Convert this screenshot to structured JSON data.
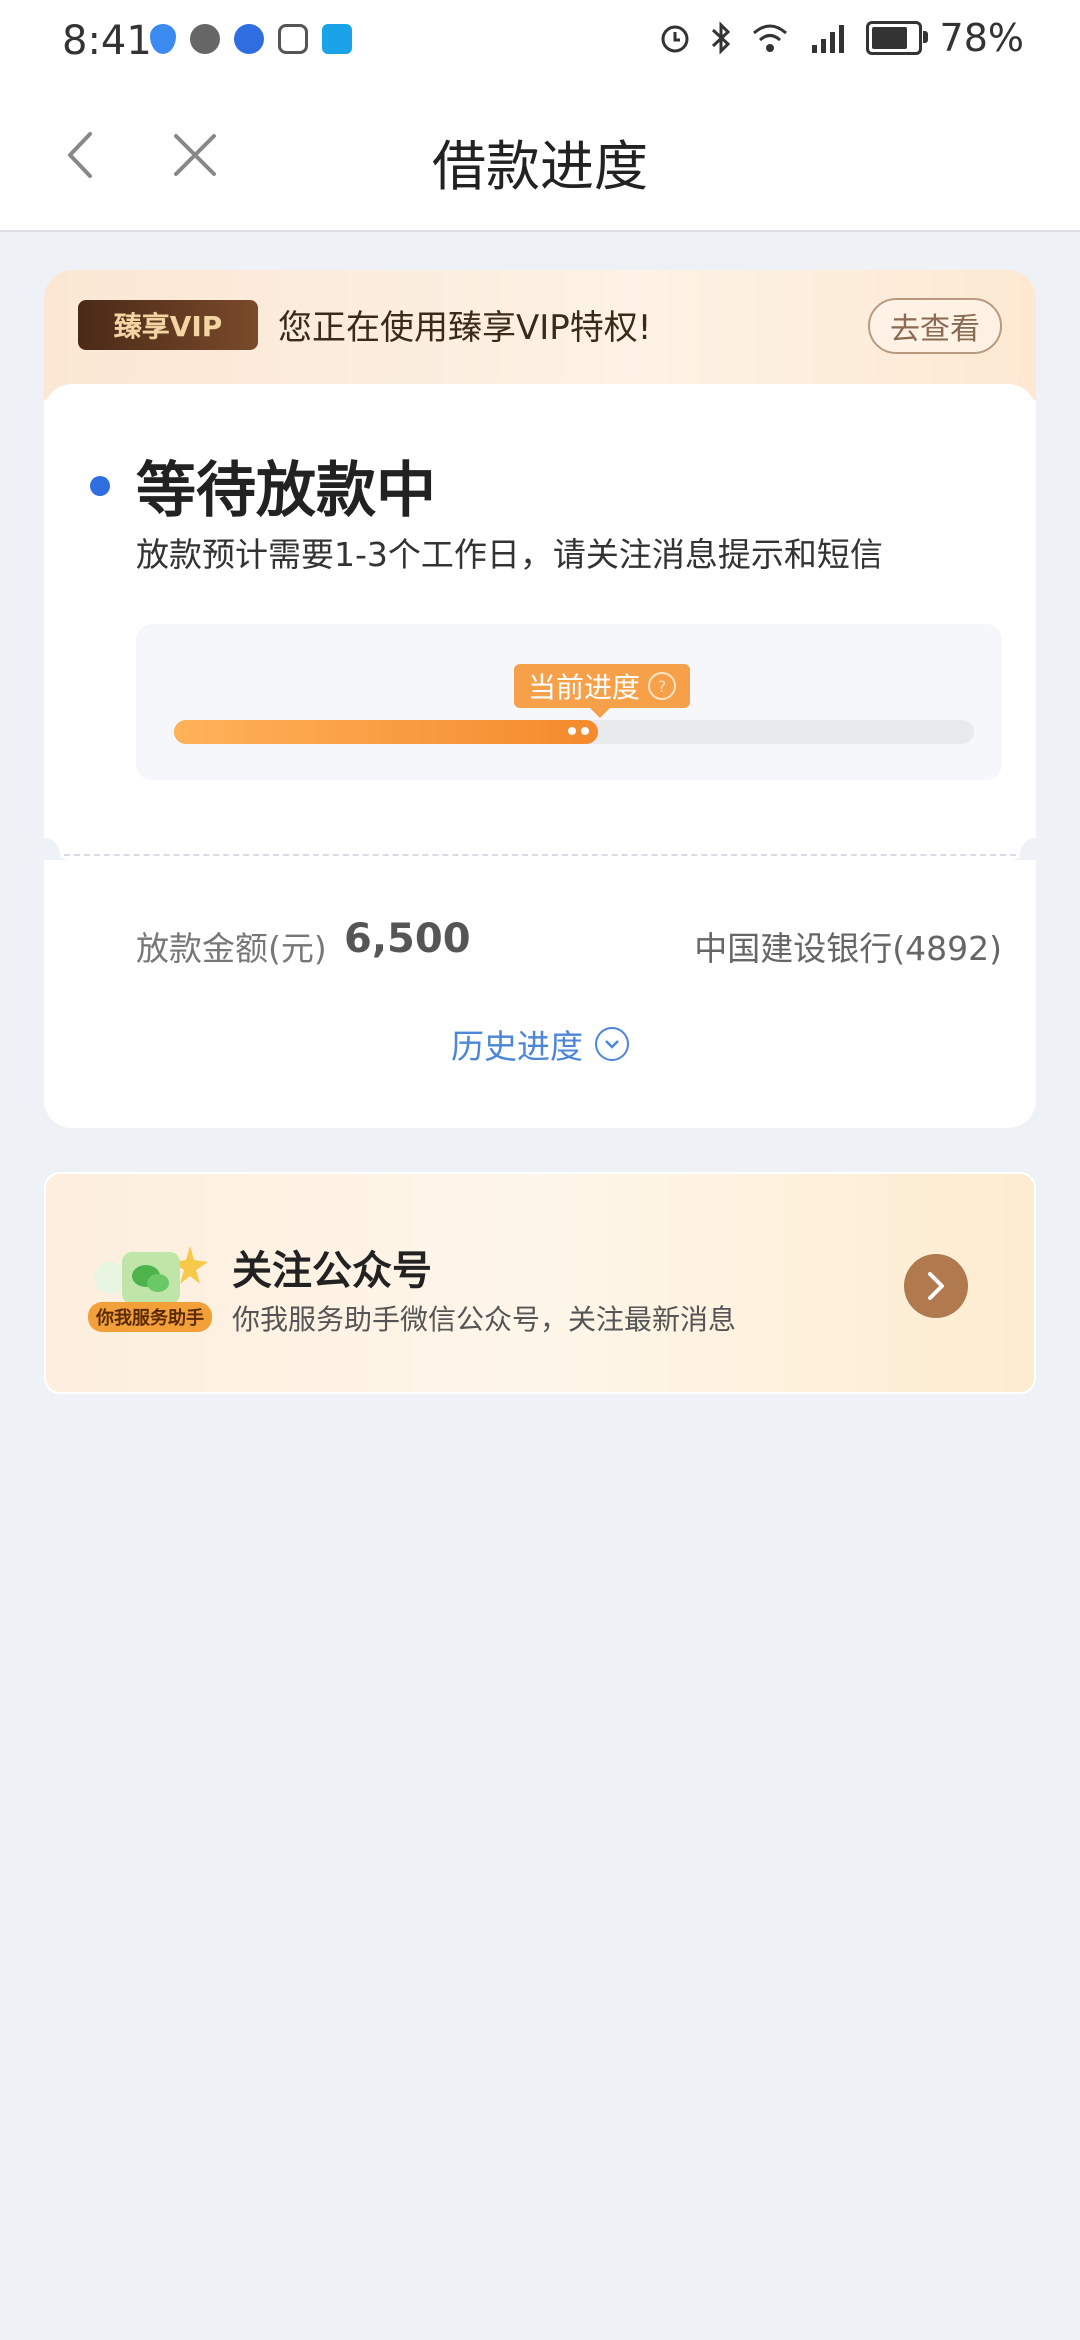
{
  "status_bar": {
    "time": "8:41",
    "battery": "78%",
    "icons": [
      "shield-app-icon",
      "wechat-icon",
      "browser-icon",
      "hand-app-icon",
      "search-app-icon",
      "alarm-icon",
      "bluetooth-icon",
      "wifi-icon",
      "signal-icon",
      "battery-icon"
    ]
  },
  "nav": {
    "title": "借款进度"
  },
  "vip": {
    "badge": "臻享VIP",
    "text": "您正在使用臻享VIP特权!",
    "button": "去查看"
  },
  "status": {
    "title": "等待放款中",
    "subtitle": "放款预计需要1-3个工作日，请关注消息提示和短信",
    "progress_label": "当前进度",
    "progress_fraction": 0.53
  },
  "loan": {
    "amount_label": "放款金额(元)",
    "amount_value": "6,500",
    "bank": "中国建设银行(4892)",
    "history_label": "历史进度"
  },
  "follow": {
    "helper_tag": "你我服务助手",
    "title": "关注公众号",
    "subtitle": "你我服务助手微信公众号，关注最新消息"
  },
  "colors": {
    "accent_blue": "#2f6ee0",
    "progress_orange": "#f48a2c",
    "link_blue": "#4c86d6",
    "arrow_brown": "#b07a4e"
  }
}
